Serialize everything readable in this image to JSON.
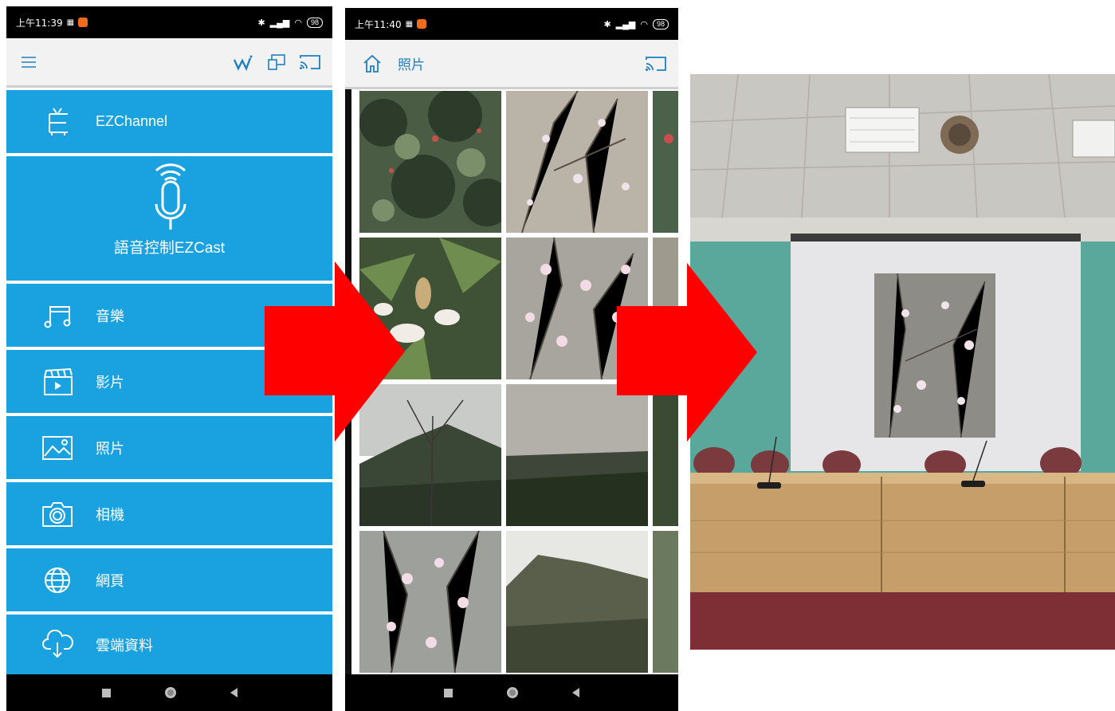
{
  "phone1": {
    "status": {
      "time": "上午11:39",
      "battery": "98"
    },
    "menu_items": [
      {
        "label": "EZChannel",
        "icon": "tv-icon"
      },
      {
        "label": "語音控制EZCast",
        "icon": "microphone-icon"
      },
      {
        "label": "音樂",
        "icon": "music-icon"
      },
      {
        "label": "影片",
        "icon": "video-icon"
      },
      {
        "label": "照片",
        "icon": "photo-icon"
      },
      {
        "label": "相機",
        "icon": "camera-icon"
      },
      {
        "label": "網頁",
        "icon": "globe-icon"
      },
      {
        "label": "雲端資料",
        "icon": "cloud-download-icon"
      }
    ]
  },
  "phone2": {
    "status": {
      "time": "上午11:40",
      "battery": "98"
    },
    "title": "照片"
  },
  "colors": {
    "menu_blue": "#1aa1df",
    "arrow_red": "#ff0000",
    "accent_blue": "#1e7fc0"
  }
}
